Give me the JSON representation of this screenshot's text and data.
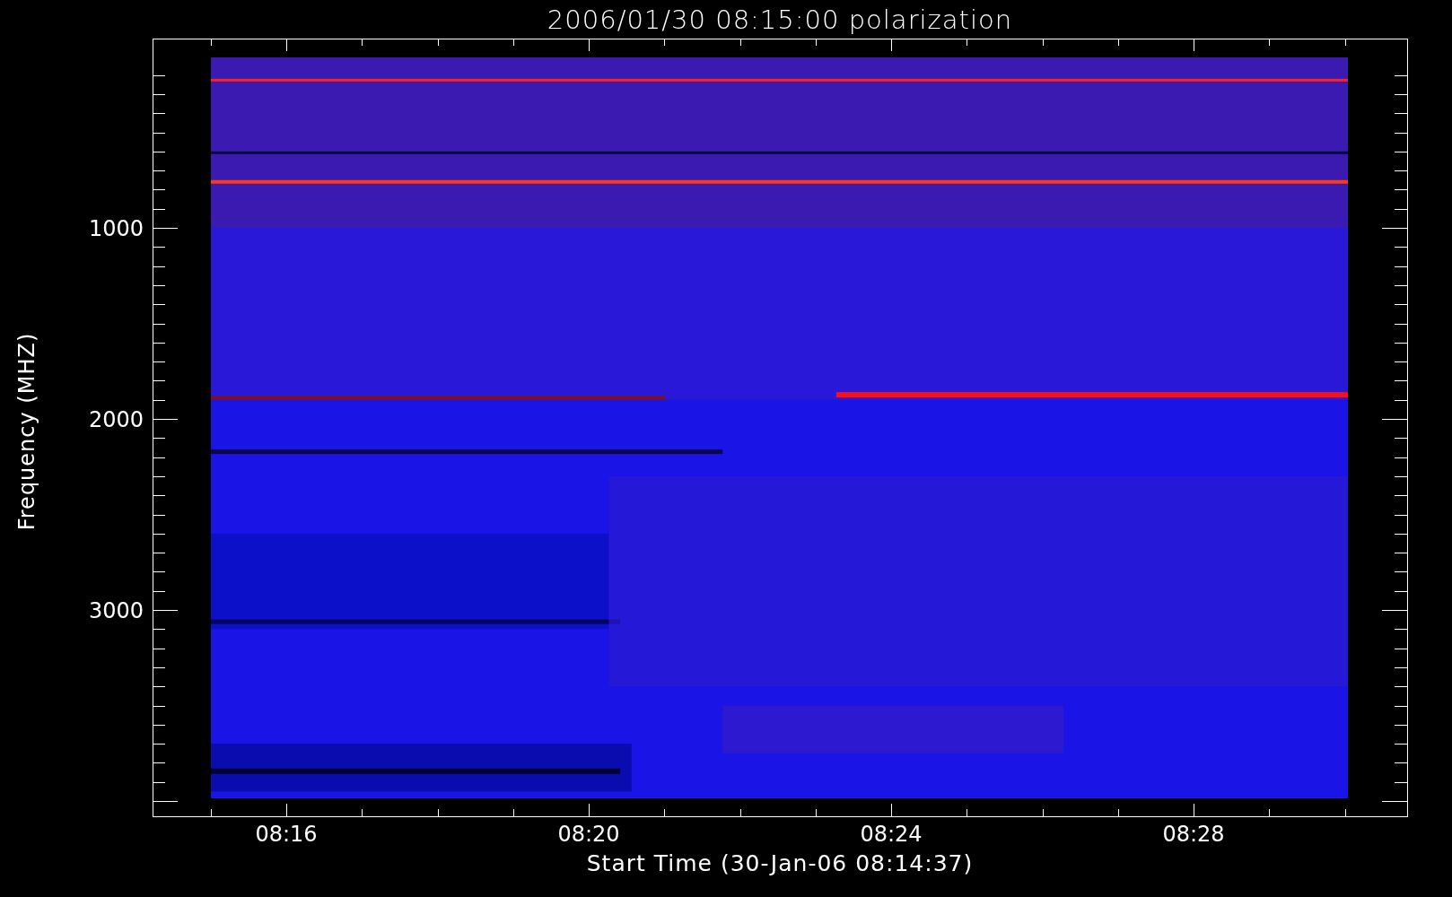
{
  "title": "2006/01/30 08:15:00 polarization",
  "y_axis": {
    "label": "Frequency (MHZ)",
    "ticks": [
      "1000",
      "2000",
      "3000"
    ]
  },
  "x_axis": {
    "label": "Start Time (30-Jan-06 08:14:37)",
    "ticks": [
      "08:16",
      "08:20",
      "08:24",
      "08:28"
    ]
  }
}
